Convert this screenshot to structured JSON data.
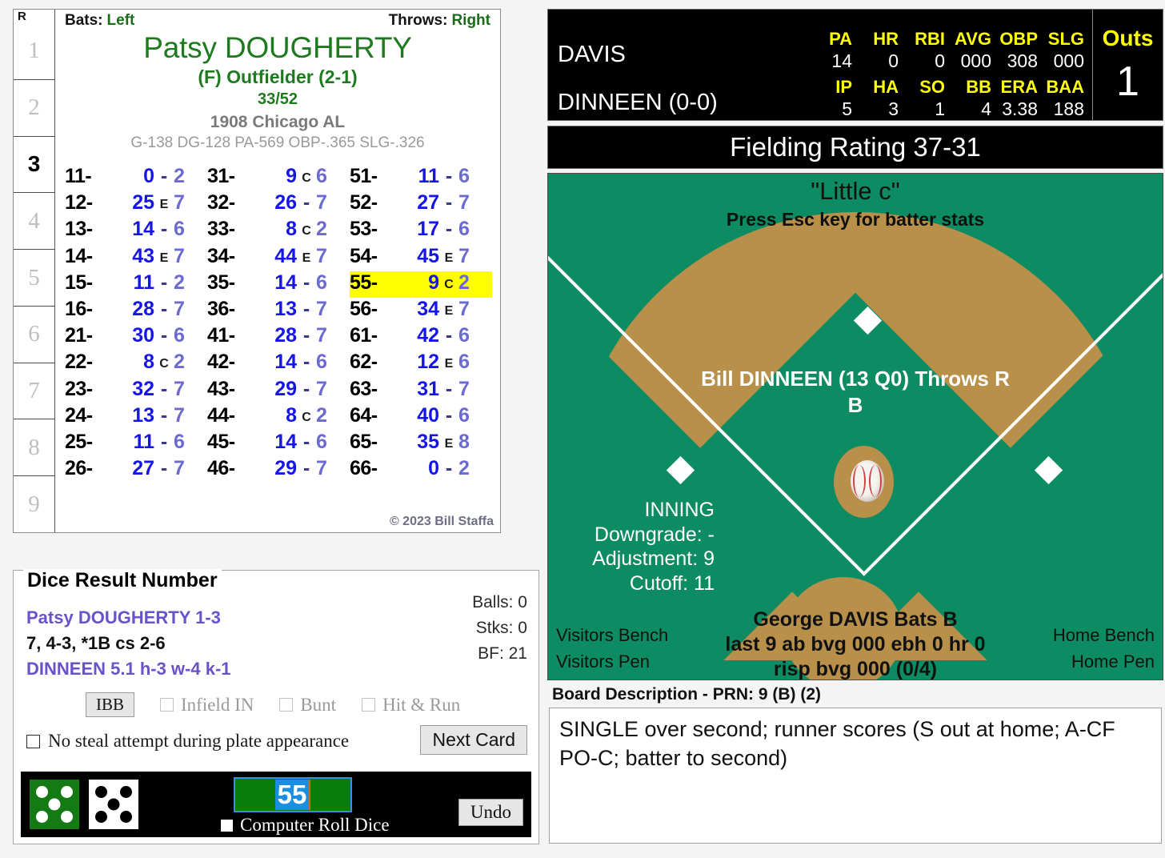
{
  "card": {
    "inning_header": "R",
    "innings": [
      "1",
      "2",
      "3",
      "4",
      "5",
      "6",
      "7",
      "8",
      "9"
    ],
    "active_inning": "3",
    "bats_label": "Bats:",
    "bats_value": "Left",
    "throws_label": "Throws:",
    "throws_value": "Right",
    "player_name": "Patsy DOUGHERTY",
    "position": "(F) Outfielder (2-1)",
    "ratio": "33/52",
    "team": "1908 Chicago AL",
    "stat_line": "G-138 DG-128 PA-569 OBP-.365 SLG-.326",
    "copyright": "© 2023 Bill Staffa",
    "columns": [
      [
        {
          "key": "11-",
          "num": "0",
          "mid": "-",
          "end": "2"
        },
        {
          "key": "12-",
          "num": "25",
          "mid": "E",
          "end": "7"
        },
        {
          "key": "13-",
          "num": "14",
          "mid": "-",
          "end": "6"
        },
        {
          "key": "14-",
          "num": "43",
          "mid": "E",
          "end": "7"
        },
        {
          "key": "15-",
          "num": "11",
          "mid": "-",
          "end": "2"
        },
        {
          "key": "16-",
          "num": "28",
          "mid": "-",
          "end": "7"
        },
        {
          "key": "21-",
          "num": "30",
          "mid": "-",
          "end": "6"
        },
        {
          "key": "22-",
          "num": "8",
          "mid": "C",
          "end": "2"
        },
        {
          "key": "23-",
          "num": "32",
          "mid": "-",
          "end": "7"
        },
        {
          "key": "24-",
          "num": "13",
          "mid": "-",
          "end": "7"
        },
        {
          "key": "25-",
          "num": "11",
          "mid": "-",
          "end": "6"
        },
        {
          "key": "26-",
          "num": "27",
          "mid": "-",
          "end": "7"
        }
      ],
      [
        {
          "key": "31-",
          "num": "9",
          "mid": "C",
          "end": "6"
        },
        {
          "key": "32-",
          "num": "26",
          "mid": "-",
          "end": "7"
        },
        {
          "key": "33-",
          "num": "8",
          "mid": "C",
          "end": "2"
        },
        {
          "key": "34-",
          "num": "44",
          "mid": "E",
          "end": "7"
        },
        {
          "key": "35-",
          "num": "14",
          "mid": "-",
          "end": "6"
        },
        {
          "key": "36-",
          "num": "13",
          "mid": "-",
          "end": "7"
        },
        {
          "key": "41-",
          "num": "28",
          "mid": "-",
          "end": "7"
        },
        {
          "key": "42-",
          "num": "14",
          "mid": "-",
          "end": "6"
        },
        {
          "key": "43-",
          "num": "29",
          "mid": "-",
          "end": "7"
        },
        {
          "key": "44-",
          "num": "8",
          "mid": "C",
          "end": "2"
        },
        {
          "key": "45-",
          "num": "14",
          "mid": "-",
          "end": "6"
        },
        {
          "key": "46-",
          "num": "29",
          "mid": "-",
          "end": "7"
        }
      ],
      [
        {
          "key": "51-",
          "num": "11",
          "mid": "-",
          "end": "6"
        },
        {
          "key": "52-",
          "num": "27",
          "mid": "-",
          "end": "7"
        },
        {
          "key": "53-",
          "num": "17",
          "mid": "-",
          "end": "6"
        },
        {
          "key": "54-",
          "num": "45",
          "mid": "E",
          "end": "7"
        },
        {
          "key": "55-",
          "num": "9",
          "mid": "C",
          "end": "2",
          "highlight": true
        },
        {
          "key": "56-",
          "num": "34",
          "mid": "E",
          "end": "7"
        },
        {
          "key": "61-",
          "num": "42",
          "mid": "-",
          "end": "6"
        },
        {
          "key": "62-",
          "num": "12",
          "mid": "E",
          "end": "6"
        },
        {
          "key": "63-",
          "num": "31",
          "mid": "-",
          "end": "7"
        },
        {
          "key": "64-",
          "num": "40",
          "mid": "-",
          "end": "6"
        },
        {
          "key": "65-",
          "num": "35",
          "mid": "E",
          "end": "8"
        },
        {
          "key": "66-",
          "num": "0",
          "mid": "-",
          "end": "2"
        }
      ]
    ]
  },
  "dice_panel": {
    "legend": "Dice Result Number",
    "line1": "Patsy DOUGHERTY  1-3",
    "line2": "7, 4-3, *1B cs 2-6",
    "line3": "DINNEEN  5.1  h-3  w-4  k-1",
    "balls": "Balls: 0",
    "strikes": "Stks: 0",
    "bf": "BF: 21",
    "ibb_label": "IBB",
    "infield_in_label": "Infield IN",
    "bunt_label": "Bunt",
    "hit_run_label": "Hit & Run",
    "no_steal_label": "No steal attempt during plate appearance",
    "next_card_label": "Next Card",
    "roll_value": "55",
    "computer_roll_label": "Computer Roll Dice",
    "undo_label": "Undo",
    "die1_pips": "5",
    "die2_pips": "5"
  },
  "scoreboard": {
    "batter_name": "DAVIS",
    "batter_headers": [
      "PA",
      "HR",
      "RBI",
      "AVG",
      "OBP",
      "SLG"
    ],
    "batter_values": [
      "14",
      "0",
      "0",
      "000",
      "308",
      "000"
    ],
    "pitcher_name": "DINNEEN (0-0)",
    "pitcher_headers": [
      "IP",
      "HA",
      "SO",
      "BB",
      "ERA",
      "BAA"
    ],
    "pitcher_values": [
      "5",
      "3",
      "1",
      "4",
      "3.38",
      "188"
    ],
    "outs_label": "Outs",
    "outs_value": "1"
  },
  "fielding": {
    "rating": "Fielding Rating 37-31"
  },
  "field": {
    "nickname": "\"Little c\"",
    "esc_hint": "Press Esc key for batter stats",
    "pitcher_line": "Bill DINNEEN (13 Q0) Throws R",
    "pitcher_line2": "B",
    "inning_title": "INNING",
    "downgrade": "Downgrade: -",
    "adjustment": "Adjustment: 9",
    "cutoff": "Cutoff: 11",
    "batter_title": "George DAVIS Bats B",
    "batter_l1": "last 9 ab bvg 000 ebh 0 hr 0",
    "batter_l2": "risp bvg 000 (0/4)",
    "visitors_bench": "Visitors Bench",
    "visitors_pen": "Visitors Pen",
    "home_bench": "Home Bench",
    "home_pen": "Home Pen"
  },
  "board": {
    "label": "Board Description - PRN: 9 (B) (2)",
    "text": "SINGLE over second; runner scores (S out at home; A-CF PO-C; batter to second)"
  },
  "colors": {
    "field_green": "#0d8b63",
    "dirt": "#b8904a",
    "highlight_yellow": "#ffff00",
    "accent_yellow": "#ffff00",
    "card_green": "#1e7a1e",
    "purple": "#6a52c9",
    "blue_num": "#1515e8"
  }
}
